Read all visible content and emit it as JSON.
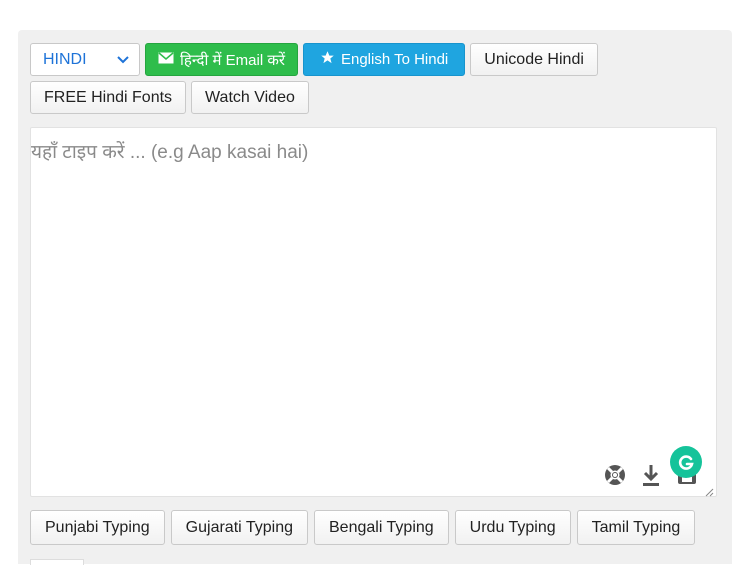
{
  "toolbar": {
    "language_select": {
      "selected": "HINDI"
    },
    "email_button": "हिन्दी में Email करें",
    "english_to_hindi": "English To Hindi",
    "unicode_hindi": "Unicode Hindi",
    "free_fonts": "FREE Hindi Fonts",
    "watch_video": "Watch Video"
  },
  "editor": {
    "placeholder": "यहाँ टाइप करें ... (e.g Aap kasai hai)",
    "value": ""
  },
  "languages": [
    {
      "label": "Punjabi Typing"
    },
    {
      "label": "Gujarati Typing"
    },
    {
      "label": "Bengali Typing"
    },
    {
      "label": "Urdu Typing"
    },
    {
      "label": "Tamil Typing"
    }
  ],
  "colors": {
    "green": "#2ebd4b",
    "blue": "#1fa5e0",
    "select_text": "#1e73d8",
    "grammarly": "#15c39a"
  },
  "icons": {
    "email": "envelope-icon",
    "star": "star-icon",
    "help": "lifebuoy-icon",
    "download": "download-icon",
    "save": "save-icon",
    "grammarly": "grammarly-icon"
  }
}
